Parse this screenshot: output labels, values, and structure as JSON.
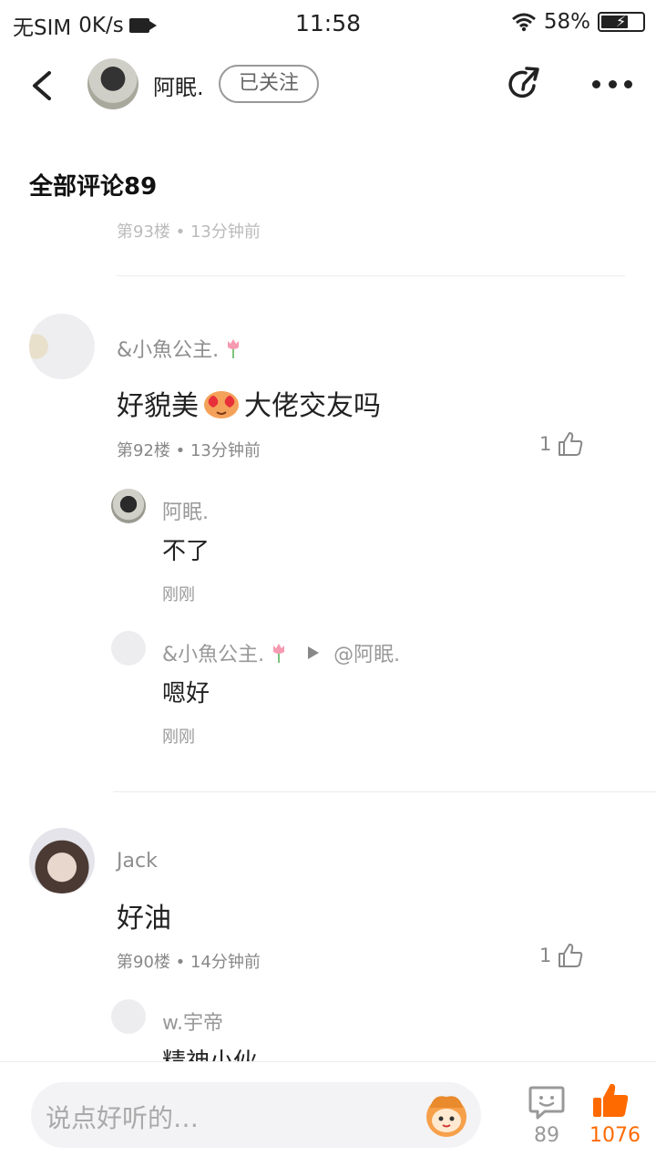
{
  "status_bar": {
    "carrier": "无SIM",
    "speed": "0K/s",
    "time": "11:58",
    "battery": "58%"
  },
  "header": {
    "username": "阿眠.",
    "follow_label": "已关注"
  },
  "section": {
    "title": "全部评论89"
  },
  "partial_row": {
    "text": "第93楼 • 13分钟前"
  },
  "comments": [
    {
      "name": "&小魚公主.",
      "text_before": "好貌美",
      "text_after": "大佬交友吗",
      "floor": "第92楼",
      "time": "13分钟前",
      "likes": "1",
      "replies": [
        {
          "name": "阿眠.",
          "text": "不了",
          "time": "刚刚"
        },
        {
          "name": "&小魚公主.",
          "reply_to": "@阿眠.",
          "text": "嗯好",
          "time": "刚刚"
        }
      ]
    },
    {
      "name": "Jack",
      "text": "好油",
      "floor": "第90楼",
      "time": "14分钟前",
      "likes": "1",
      "replies": [
        {
          "name": "w.宇帝",
          "text": "精神小伙"
        }
      ]
    }
  ],
  "bottom_bar": {
    "placeholder": "说点好听的…",
    "comment_count": "89",
    "like_count": "1076",
    "accent_color": "#ff6a00"
  }
}
